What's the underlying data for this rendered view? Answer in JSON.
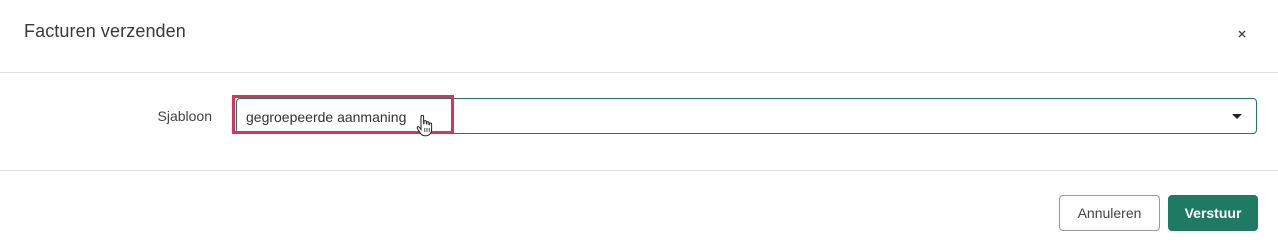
{
  "dialog": {
    "title": "Facturen verzenden",
    "close_icon": "close-icon"
  },
  "form": {
    "template_label": "Sjabloon",
    "template_value": "gegroepeerde aanmaning",
    "dropdown_icon": "chevron-down-icon"
  },
  "footer": {
    "cancel_label": "Annuleren",
    "send_label": "Verstuur"
  },
  "colors": {
    "accent": "#1e7a62",
    "highlight": "#d6345a",
    "divider": "#dedede"
  }
}
